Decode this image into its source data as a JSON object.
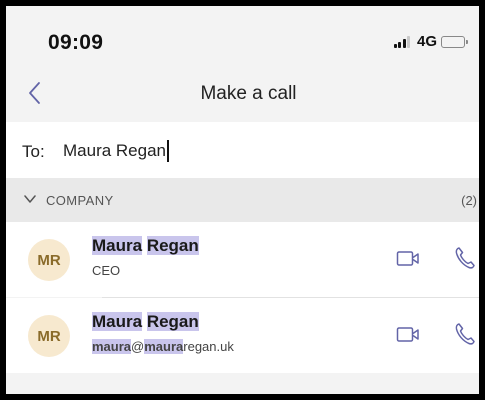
{
  "status_bar": {
    "time": "09:09",
    "network": "4G",
    "battery_color": "#f5c400"
  },
  "nav": {
    "title": "Make a call",
    "back_icon": "chevron-left-icon"
  },
  "to_field": {
    "label": "To:",
    "value": "Maura Regan"
  },
  "section": {
    "title": "COMPANY",
    "count": "(2)",
    "icon": "chevron-down-icon"
  },
  "contacts": [
    {
      "initials": "MR",
      "first": "Maura",
      "last": "Regan",
      "subtitle": "CEO"
    },
    {
      "initials": "MR",
      "first": "Maura",
      "last": "Regan",
      "email_user": "maura",
      "email_at": "@",
      "email_domain_hl": "maura",
      "email_domain_rest": "regan.uk"
    }
  ],
  "colors": {
    "accent": "#6264a7",
    "highlight": "#c9c5ec",
    "avatar_bg": "#f7e9cf"
  }
}
